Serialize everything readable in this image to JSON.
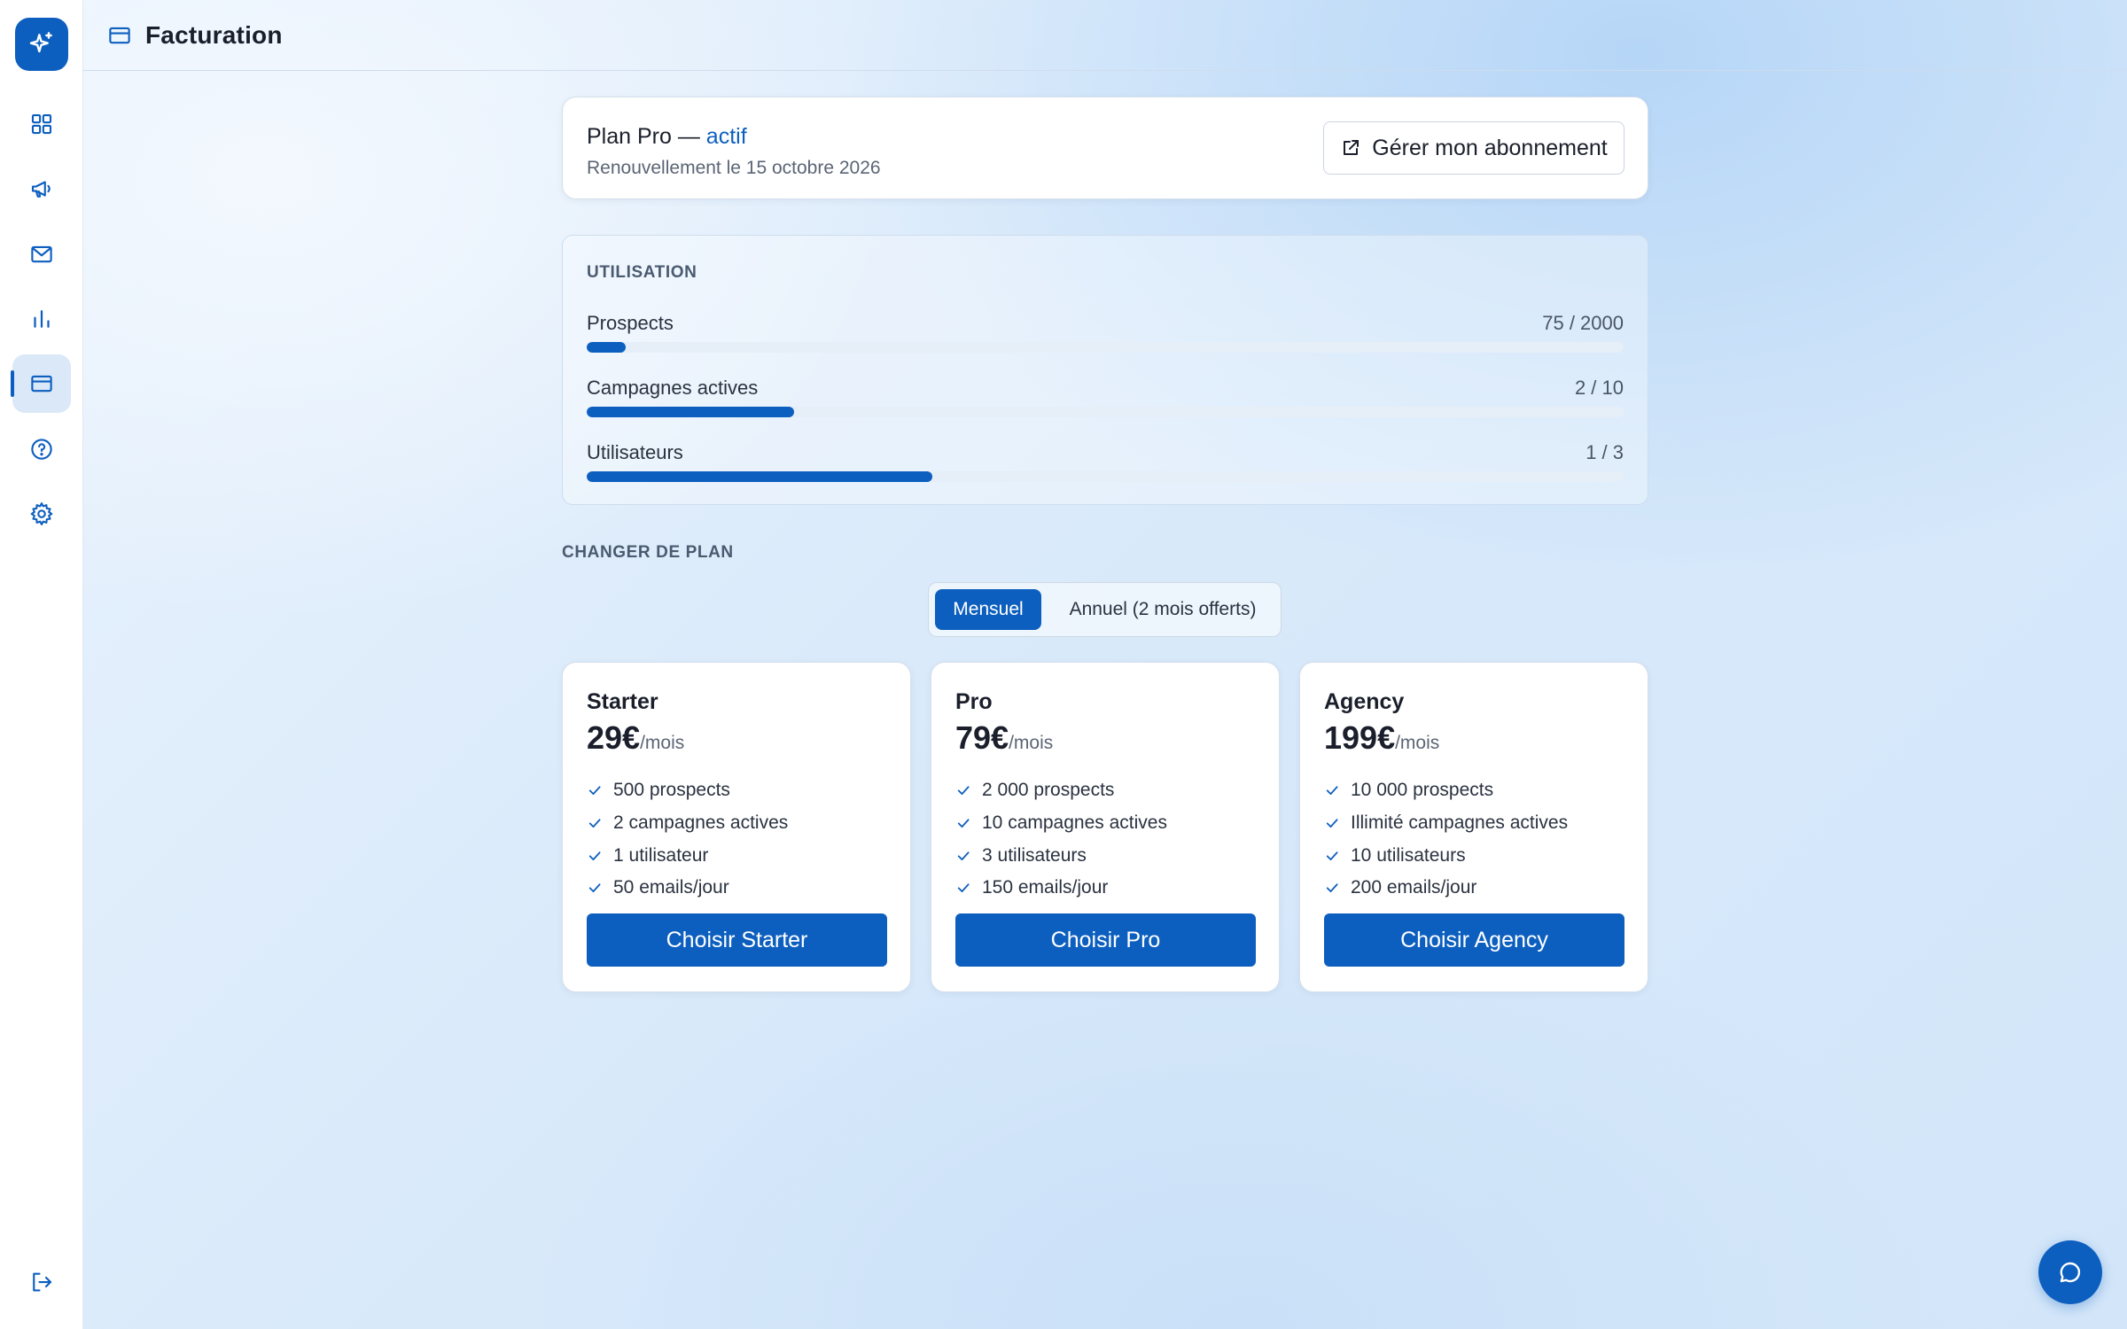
{
  "colors": {
    "accent": "#0d5fbf"
  },
  "sidebar": {
    "logo_icon": "sparkles-icon",
    "items": [
      {
        "icon": "grid-icon"
      },
      {
        "icon": "megaphone-icon"
      },
      {
        "icon": "mail-icon"
      },
      {
        "icon": "bar-chart-icon"
      },
      {
        "icon": "credit-card-icon",
        "active": true
      },
      {
        "icon": "help-circle-icon"
      },
      {
        "icon": "gear-icon"
      }
    ],
    "logout_icon": "logout-icon"
  },
  "header": {
    "title": "Facturation",
    "icon": "credit-card-icon"
  },
  "plan": {
    "title": "Plan Pro —",
    "status": "actif",
    "renewal": "Renouvellement le 15 octobre 2026",
    "manage_label": "Gérer mon abonnement"
  },
  "usage": {
    "heading": "UTILISATION",
    "rows": [
      {
        "label": "Prospects",
        "value": "75 / 2000",
        "fraction": 0.0375
      },
      {
        "label": "Campagnes actives",
        "value": "2 / 10",
        "fraction": 0.2
      },
      {
        "label": "Utilisateurs",
        "value": "1 / 3",
        "fraction": 0.3333
      }
    ]
  },
  "change_plan": {
    "heading": "CHANGER DE PLAN",
    "billing_options": [
      "Mensuel",
      "Annuel (2 mois offerts)"
    ],
    "selected_billing": "Mensuel"
  },
  "plans": [
    {
      "name": "Starter",
      "price": "29€",
      "period": "/mois",
      "features": [
        "500 prospects",
        "2 campagnes actives",
        "1 utilisateur",
        "50 emails/jour"
      ],
      "cta": "Choisir Starter"
    },
    {
      "name": "Pro",
      "price": "79€",
      "period": "/mois",
      "features": [
        "2 000 prospects",
        "10 campagnes actives",
        "3 utilisateurs",
        "150 emails/jour"
      ],
      "cta": "Choisir Pro"
    },
    {
      "name": "Agency",
      "price": "199€",
      "period": "/mois",
      "features": [
        "10 000 prospects",
        "Illimité campagnes actives",
        "10 utilisateurs",
        "200 emails/jour"
      ],
      "cta": "Choisir Agency"
    }
  ],
  "chat": {
    "icon": "chat-bubble-icon"
  }
}
